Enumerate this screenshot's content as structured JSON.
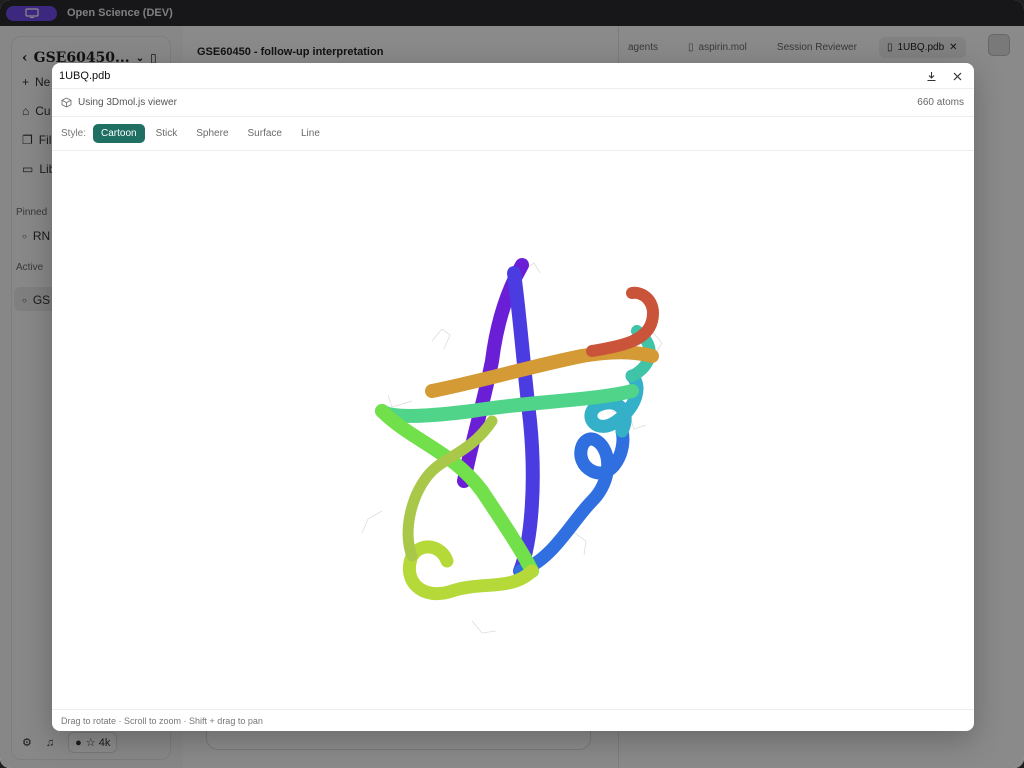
{
  "app": {
    "title": "Open Science (DEV)"
  },
  "sidebar": {
    "workspace": "GSE60450...",
    "items": [
      {
        "label": "Ne",
        "icon": "plus-icon"
      },
      {
        "label": "Cu",
        "icon": "inbox-icon"
      },
      {
        "label": "File",
        "icon": "files-icon"
      },
      {
        "label": "Lib",
        "icon": "book-icon"
      }
    ],
    "pinned_label": "Pinned",
    "pinned_item": "RN",
    "active_label": "Active",
    "active_item": "GS",
    "github_stars": "☆ 4k"
  },
  "chat": {
    "title": "GSE60450 - follow-up interpretation"
  },
  "tabs": [
    {
      "label": "agents"
    },
    {
      "label": "aspirin.mol"
    },
    {
      "label": "Session Reviewer"
    },
    {
      "label": "1UBQ.pdb",
      "active": true
    }
  ],
  "modal": {
    "title": "1UBQ.pdb",
    "viewer_info": "Using 3Dmol.js viewer",
    "atom_count": "660 atoms",
    "style_label": "Style:",
    "styles": [
      "Cartoon",
      "Stick",
      "Sphere",
      "Surface",
      "Line"
    ],
    "active_style": "Cartoon",
    "footer_hint": "Drag to rotate · Scroll to zoom · Shift + drag to pan"
  },
  "colors": {
    "accent": "#6e4ce8",
    "style_active": "#1f6f63",
    "ribbon": [
      "#6a1fd6",
      "#4a3ce0",
      "#2f6fe0",
      "#34b0c8",
      "#4fd48a",
      "#72e04a",
      "#b6d93a",
      "#d39a35",
      "#c9543a"
    ]
  }
}
